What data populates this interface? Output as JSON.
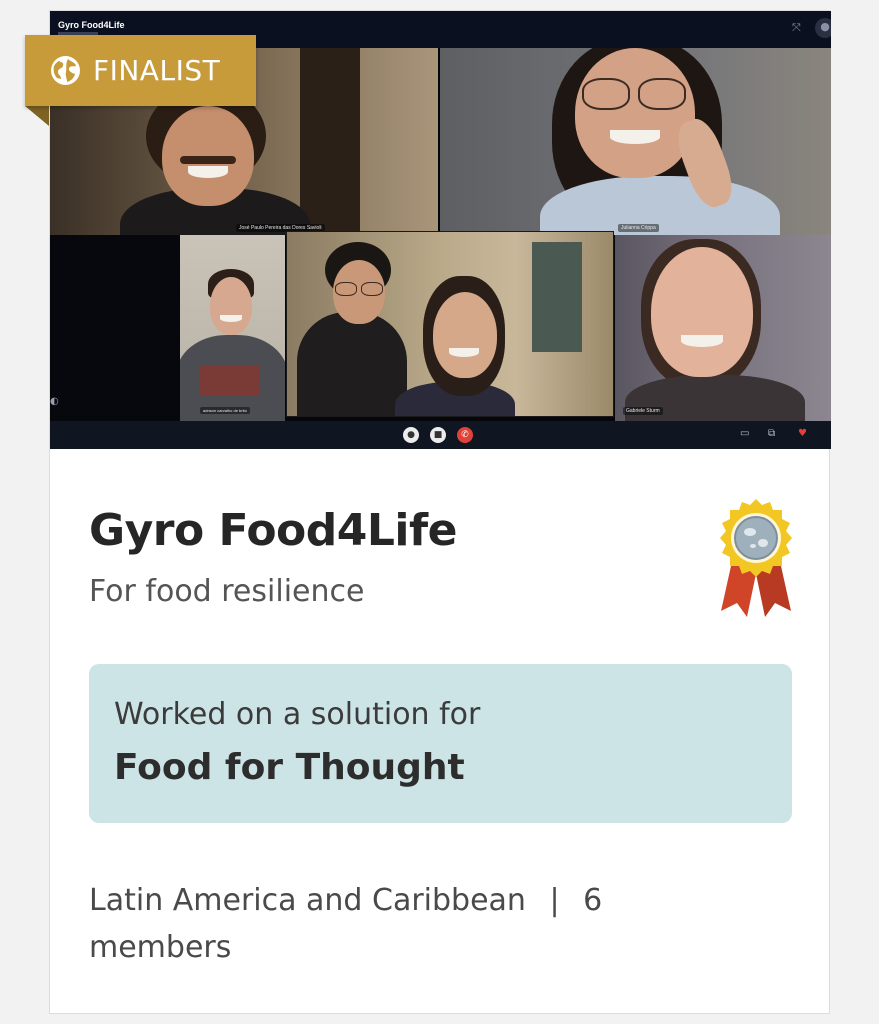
{
  "call": {
    "window_title": "Gyro Food4Life",
    "participants": [
      {
        "name": "José Paulo Pereira das Dores Savioli"
      },
      {
        "name": "Julianna Crippa"
      },
      {
        "name": "adnson carvalho de brito"
      },
      {
        "name": ""
      },
      {
        "name": "Gabriele Sturm"
      }
    ],
    "icons": [
      "mic-icon",
      "camera-icon",
      "hang-up-icon",
      "chat-icon",
      "layout-icon",
      "heart-icon"
    ]
  },
  "badge": {
    "label": "FINALIST",
    "icon": "globe-icon",
    "color": "#c89b3a"
  },
  "team": {
    "name": "Gyro Food4Life",
    "tagline": "For food resilience",
    "medal_icon": "medal-icon"
  },
  "challenge": {
    "label": "Worked on a solution for",
    "name": "Food for Thought",
    "background": "#cce4e6"
  },
  "meta": {
    "region": "Latin America and Caribbean",
    "separator": "|",
    "members": "6 members"
  }
}
